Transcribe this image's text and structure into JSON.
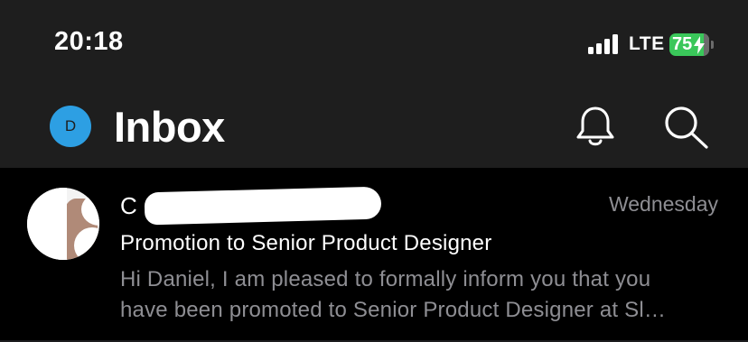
{
  "status_bar": {
    "time": "20:18",
    "network": "LTE",
    "battery_percent": "75",
    "battery_charging": true,
    "icons": [
      "signal-icon",
      "battery-icon",
      "charging-bolt-icon"
    ]
  },
  "header": {
    "avatar_initial": "D",
    "title": "Inbox",
    "icons": [
      "bell-icon",
      "search-icon"
    ],
    "colors": {
      "background": "#1e1e1e",
      "avatar": "#2d9fe3"
    }
  },
  "messages": [
    {
      "sender_visible": "C",
      "sender_redacted": true,
      "date": "Wednesday",
      "subject": "Promotion to Senior Product Designer",
      "preview_line1": "Hi Daniel, I am pleased to formally inform you that you",
      "preview_line2": "have been promoted to Senior Product Designer at Sl…"
    }
  ],
  "colors": {
    "list_background": "#000000",
    "secondary_text": "#8e8e93",
    "battery": "#3ac75a"
  }
}
